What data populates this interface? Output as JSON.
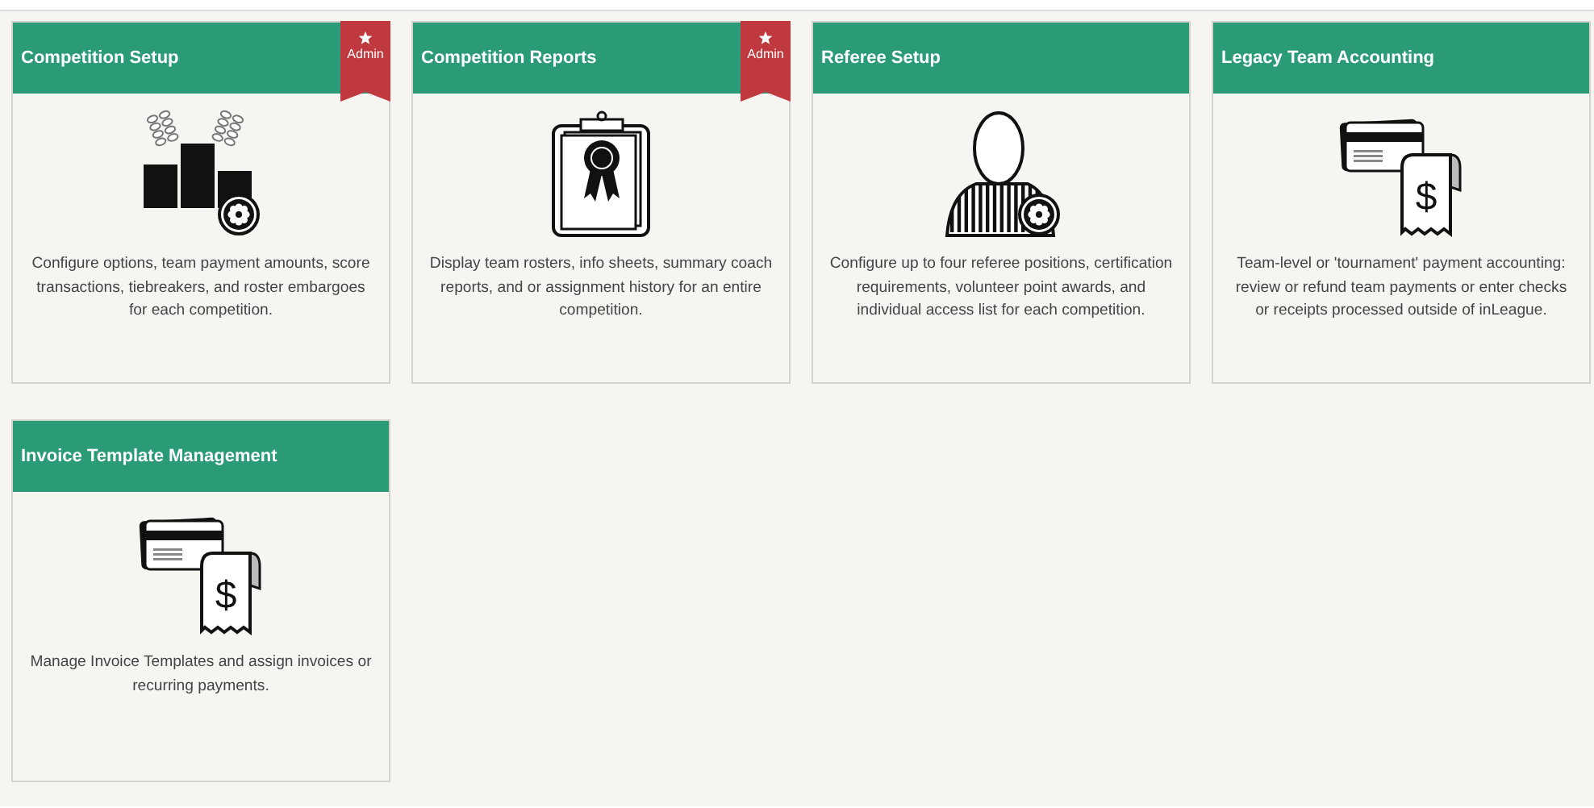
{
  "tiles": [
    {
      "title": "Competition Setup",
      "kind": "podium",
      "badge": {
        "label": "Admin"
      },
      "description": "Configure options, team payment amounts, score transactions, tiebreakers, and roster embargoes for each competition."
    },
    {
      "title": "Competition Reports",
      "kind": "clipboard",
      "badge": {
        "label": "Admin"
      },
      "description": "Display team rosters, info sheets, summary coach reports, and or assignment history for an entire competition."
    },
    {
      "title": "Referee Setup",
      "kind": "referee",
      "description": "Configure up to four referee positions, certification requirements, volunteer point awards, and individual access list for each competition."
    },
    {
      "title": "Legacy Team Accounting",
      "kind": "payment",
      "symbol": "$",
      "description": "Team-level or 'tournament' payment accounting: review or refund team payments or enter checks or receipts processed outside of inLeague."
    },
    {
      "title": "Invoice Template Management",
      "kind": "payment",
      "symbol": "$",
      "description": "Manage Invoice Templates and assign invoices or recurring payments."
    }
  ]
}
